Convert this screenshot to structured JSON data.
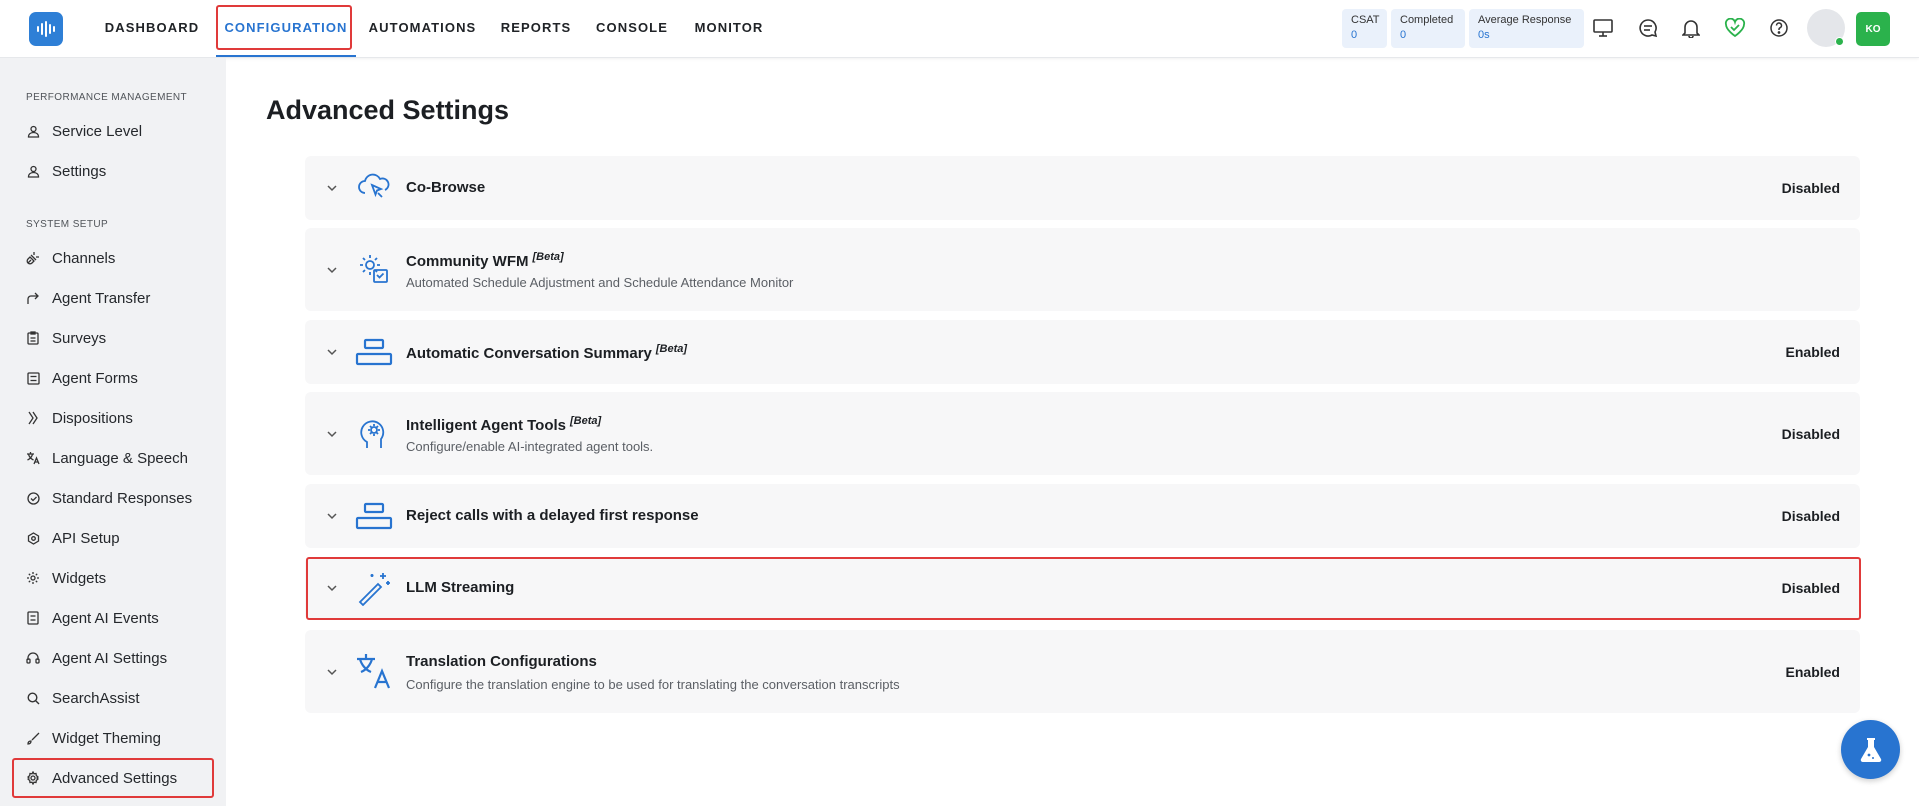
{
  "nav": {
    "tabs": [
      {
        "label": "DASHBOARD"
      },
      {
        "label": "CONFIGURATION"
      },
      {
        "label": "AUTOMATIONS"
      },
      {
        "label": "REPORTS"
      },
      {
        "label": "CONSOLE"
      },
      {
        "label": "MONITOR"
      }
    ],
    "active_tab": "CONFIGURATION"
  },
  "stats": [
    {
      "label": "CSAT",
      "value": "0"
    },
    {
      "label": "Completed",
      "value": "0"
    },
    {
      "label": "Average Response",
      "value": "0s"
    }
  ],
  "top_icons": [
    "monitor-icon",
    "chat-icon",
    "bell-icon",
    "heart-check-icon",
    "help-icon"
  ],
  "user": {
    "initials": "KO",
    "status_color": "#2bb24c"
  },
  "sidebar": {
    "sections": [
      {
        "title": "PERFORMANCE MANAGEMENT",
        "items": [
          {
            "label": "Service Level",
            "icon": "people-icon"
          },
          {
            "label": "Settings",
            "icon": "people-icon"
          }
        ]
      },
      {
        "title": "SYSTEM SETUP",
        "items": [
          {
            "label": "Channels",
            "icon": "plug-icon"
          },
          {
            "label": "Agent Transfer",
            "icon": "transfer-icon"
          },
          {
            "label": "Surveys",
            "icon": "clipboard-icon"
          },
          {
            "label": "Agent Forms",
            "icon": "form-icon"
          },
          {
            "label": "Dispositions",
            "icon": "dispositions-icon"
          },
          {
            "label": "Language & Speech",
            "icon": "translate-icon"
          },
          {
            "label": "Standard Responses",
            "icon": "check-circle-icon"
          },
          {
            "label": "API Setup",
            "icon": "api-icon"
          },
          {
            "label": "Widgets",
            "icon": "gear-icon"
          },
          {
            "label": "Agent AI Events",
            "icon": "list-icon"
          },
          {
            "label": "Agent AI Settings",
            "icon": "headset-icon"
          },
          {
            "label": "SearchAssist",
            "icon": "search-icon"
          },
          {
            "label": "Widget Theming",
            "icon": "brush-icon"
          },
          {
            "label": "Advanced Settings",
            "icon": "gear-advanced-icon"
          }
        ]
      }
    ],
    "active_item": "Advanced Settings"
  },
  "page": {
    "title": "Advanced Settings"
  },
  "settings": [
    {
      "title": "Co-Browse",
      "beta": "",
      "description": "",
      "status": "Disabled",
      "icon": "cloud-cursor-icon"
    },
    {
      "title": "Community WFM",
      "beta": "[Beta]",
      "description": "Automated Schedule Adjustment and Schedule Attendance Monitor",
      "status": "",
      "icon": "calendar-gear-icon"
    },
    {
      "title": "Automatic Conversation Summary",
      "beta": "[Beta]",
      "description": "",
      "status": "Enabled",
      "icon": "summary-icon"
    },
    {
      "title": "Intelligent Agent Tools",
      "beta": "[Beta]",
      "description": "Configure/enable AI-integrated agent tools.",
      "status": "Disabled",
      "icon": "ai-head-icon"
    },
    {
      "title": "Reject calls with a delayed first response",
      "beta": "",
      "description": "",
      "status": "Disabled",
      "icon": "reject-icon"
    },
    {
      "title": "LLM Streaming",
      "beta": "",
      "description": "",
      "status": "Disabled",
      "icon": "magic-wand-icon"
    },
    {
      "title": "Translation Configurations",
      "beta": "",
      "description": "Configure the translation engine to be used for translating the conversation transcripts",
      "status": "Enabled",
      "icon": "translate-icon"
    }
  ],
  "colors": {
    "accent": "#2874d0",
    "highlight": "#e03a3a",
    "online": "#2bb24c"
  }
}
